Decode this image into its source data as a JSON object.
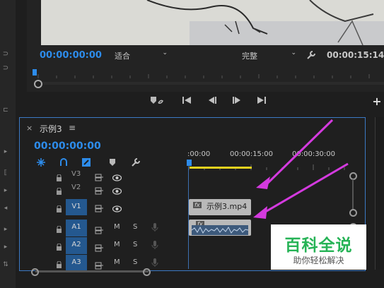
{
  "program_monitor": {
    "timecode_current": "00:00:00:00",
    "fit_select": "适合",
    "quality_select": "完整",
    "timecode_duration": "00:00:15:14"
  },
  "transport": {
    "icons": [
      "add-marker-icon",
      "go-to-in-icon",
      "step-back-icon",
      "play-icon",
      "go-to-out-icon",
      "add-button-icon"
    ]
  },
  "sequence": {
    "tab_title": "示例3",
    "close_glyph": "×",
    "menu_glyph": "≡",
    "playhead_timecode": "00:00:00:00",
    "ruler_labels": [
      ":00:00",
      "00:00:15:00",
      "00:00:30:00"
    ]
  },
  "tracks": [
    {
      "name": "V3",
      "target": false,
      "kind": "video"
    },
    {
      "name": "V2",
      "target": false,
      "kind": "video"
    },
    {
      "name": "V1",
      "target": true,
      "kind": "video"
    },
    {
      "name": "A1",
      "target": true,
      "kind": "audio"
    },
    {
      "name": "A2",
      "target": true,
      "kind": "audio"
    },
    {
      "name": "A3",
      "target": true,
      "kind": "audio"
    }
  ],
  "audio_buttons": {
    "mute": "M",
    "solo": "S"
  },
  "clips": {
    "video_clip_name": "示例3.mp4",
    "fx_badge": "fx"
  },
  "watermark": {
    "title": "百科全说",
    "subtitle": "助你轻松解决"
  },
  "colors": {
    "accent_blue": "#2d8ceb",
    "annotation_arrow": "#d43adf",
    "work_area_yellow": "#e6d21e"
  }
}
